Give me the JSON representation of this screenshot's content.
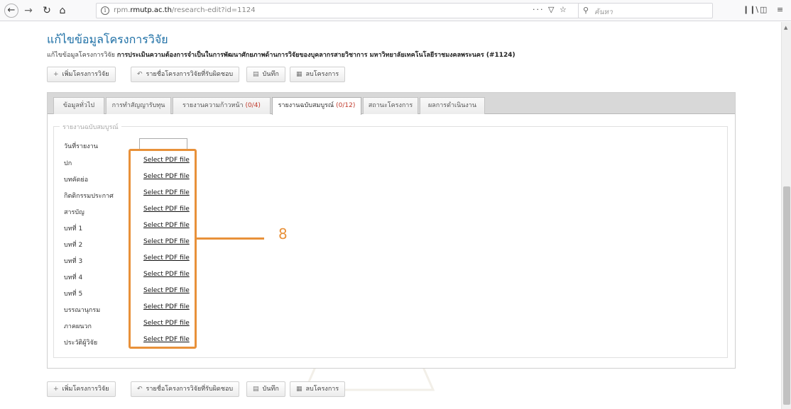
{
  "browser": {
    "url_prefix": "rpm.",
    "url_host": "rmutp.ac.th",
    "url_path": "/research-edit?id=1124",
    "search_placeholder": "ค้นหา",
    "icons": [
      "back-arrow-icon",
      "forward-arrow-icon",
      "reload-icon",
      "home-icon",
      "info-icon",
      "more-dots-icon",
      "pocket-icon",
      "bookmark-star-icon",
      "search-icon",
      "library-icon",
      "sidebar-icon",
      "menu-icon"
    ]
  },
  "page": {
    "title": "แก้ไขข้อมูลโครงการวิจัย",
    "subtitle_prefix": "แก้ไขข้อมูลโครงการวิจัย",
    "subtitle_project": "การประเมินความต้องการจำเป็นในการพัฒนาศักยภาพด้านการวิจัยของบุคลากรสายวิชาการ มหาวิทยาลัยเทคโนโลยีราชมงคลพระนคร (#1124)"
  },
  "actions": {
    "add_project": "เพิ่มโครงการวิจัย",
    "my_projects": "รายชื่อโครงการวิจัยที่รับผิดชอบ",
    "save": "บันทึก",
    "delete_project": "ลบโครงการ"
  },
  "tabs": [
    {
      "label": "ข้อมูลทั่วไป",
      "count": ""
    },
    {
      "label": "การทำสัญญารับทุน",
      "count": ""
    },
    {
      "label": "รายงานความก้าวหน้า ",
      "count": "(0/4)"
    },
    {
      "label": "รายงานฉบับสมบูรณ์ ",
      "count": "(0/12)"
    },
    {
      "label": "สถานะโครงการ",
      "count": ""
    },
    {
      "label": "ผลการดำเนินงาน",
      "count": ""
    }
  ],
  "form": {
    "legend": "รายงานฉบับสมบูรณ์",
    "report_date_label": "วันที่รายงาน",
    "report_date_value": "",
    "link_text": "Select PDF file",
    "rows": [
      {
        "label": "ปก"
      },
      {
        "label": "บทคัดย่อ"
      },
      {
        "label": "กิตติกรรมประกาศ"
      },
      {
        "label": "สารบัญ"
      },
      {
        "label": "บทที่ 1"
      },
      {
        "label": "บทที่ 2"
      },
      {
        "label": "บทที่ 3"
      },
      {
        "label": "บทที่ 4"
      },
      {
        "label": "บทที่ 5"
      },
      {
        "label": "บรรณานุกรม"
      },
      {
        "label": "ภาคผนวก"
      },
      {
        "label": "ประวัติผู้วิจัย"
      }
    ]
  },
  "annotation": {
    "number": "8",
    "color": "#e8913a"
  },
  "colors": {
    "title": "#1d6fa5",
    "count": "#c0392b",
    "accent": "#e8913a"
  }
}
